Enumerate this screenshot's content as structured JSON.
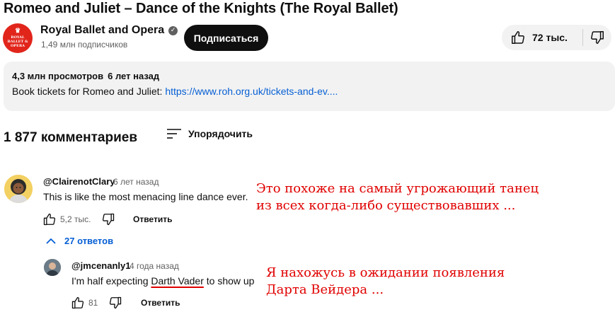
{
  "video": {
    "title": "Romeo and Juliet – Dance of the Knights (The Royal Ballet)"
  },
  "channel": {
    "name": "Royal Ballet and Opera",
    "subscribers": "1,49 млн подписчиков",
    "logo_text": [
      "ROYAL",
      "BALLET &",
      "OPERA"
    ],
    "subscribe_label": "Подписаться"
  },
  "actions": {
    "likes": "72 тыс."
  },
  "description": {
    "views": "4,3 млн просмотров",
    "age": "6 лет назад",
    "text_prefix": "Book tickets for Romeo and Juliet: ",
    "link": "https://www.roh.org.uk/tickets-and-ev...."
  },
  "comments": {
    "count_label": "1 877 комментариев",
    "sort_label": "Упорядочить",
    "reply_label": "Ответить",
    "items": [
      {
        "handle": "@ClairenotClary",
        "time": "6 лет назад",
        "text": "This is like the most menacing line dance ever.",
        "likes": "5,2 тыс.",
        "replies_toggle": "27 ответов"
      },
      {
        "handle": "@jmcenanly1",
        "time": "4 года назад",
        "text_before": "I'm half expecting ",
        "text_highlight": "Darth Vader",
        "text_after": " to show up",
        "likes": "81"
      }
    ]
  },
  "annotations": {
    "first": [
      "Это похоже на самый угрожающий танец",
      "из всех когда-либо существовавших ..."
    ],
    "second": [
      "Я нахожусь в ожидании появления",
      "Дарта Вейдера ..."
    ],
    "color": "#e00000"
  },
  "colors": {
    "brand": "#e1251b",
    "link": "#065fd4",
    "panel": "#f2f2f2"
  }
}
